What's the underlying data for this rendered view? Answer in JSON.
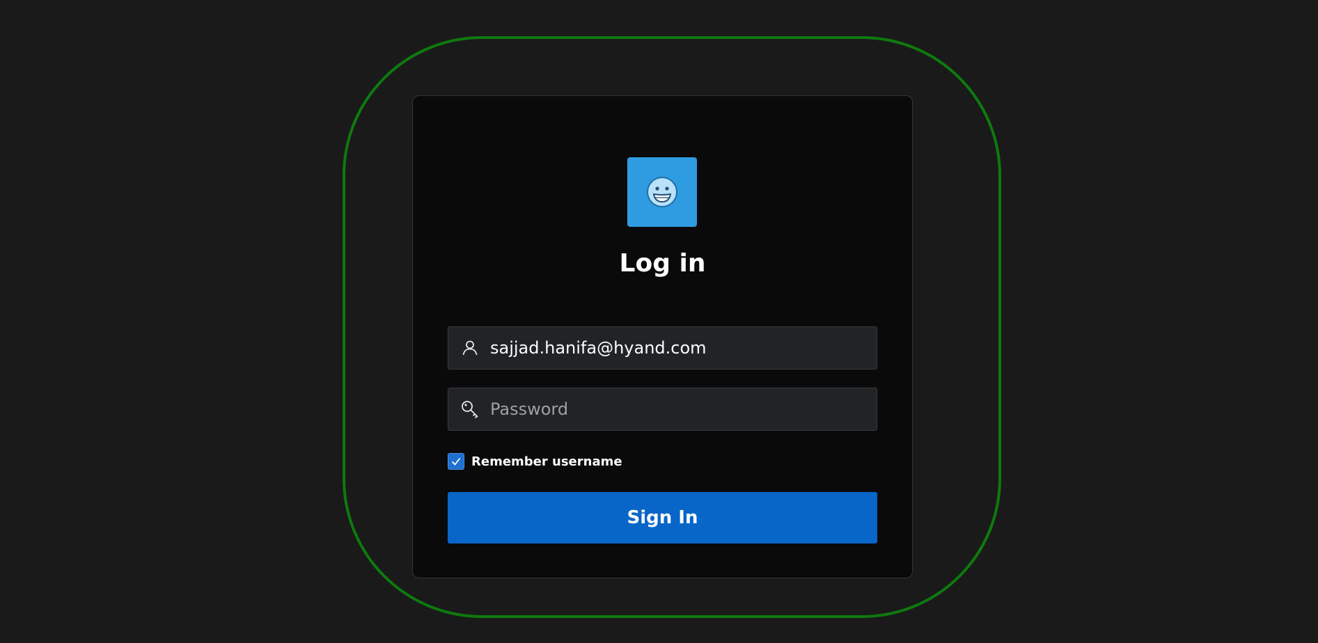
{
  "login": {
    "title": "Log in",
    "username": {
      "value": "sajjad.hanifa@hyand.com",
      "icon": "user-icon"
    },
    "password": {
      "value": "",
      "placeholder": "Password",
      "icon": "key-icon"
    },
    "remember": {
      "label": "Remember username",
      "checked": true
    },
    "submit_label": "Sign In",
    "logo_icon": "smiley-face-icon"
  },
  "colors": {
    "page_background": "#1a1a1a",
    "card_background": "#0a0a0a",
    "focus_outline": "#0e7a0e",
    "logo_background": "#2f9be0",
    "primary_button": "#0766c8",
    "checkbox": "#1e6fd0"
  }
}
